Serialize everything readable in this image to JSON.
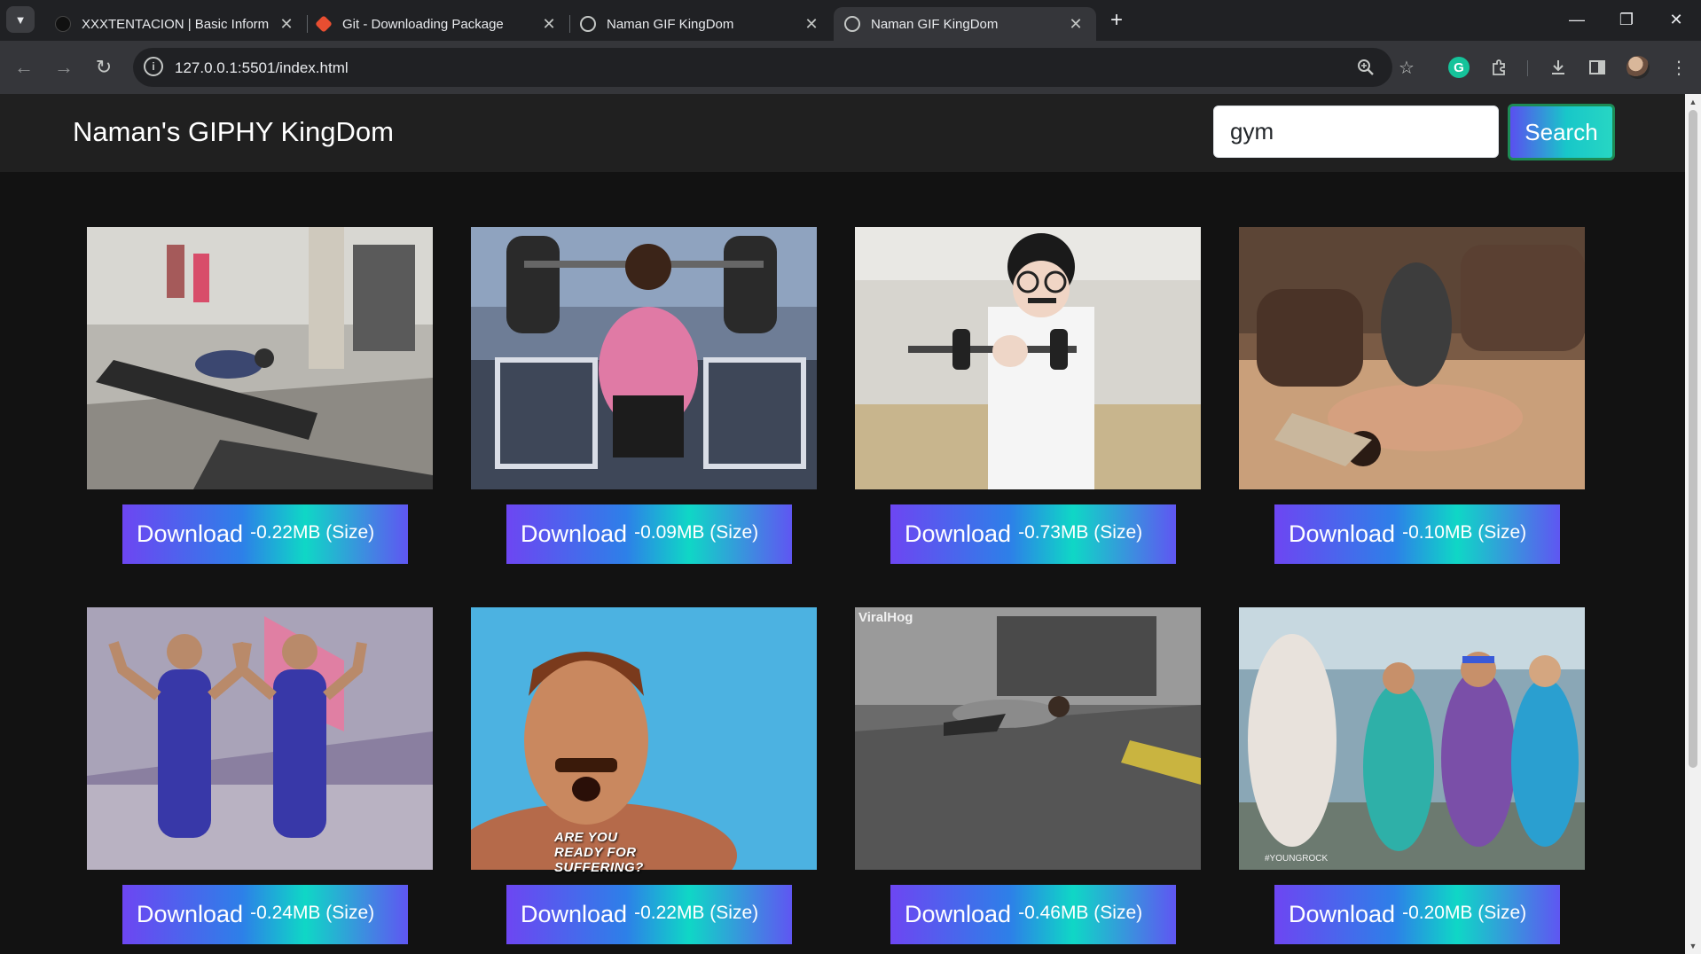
{
  "browser": {
    "tabs": [
      {
        "title": "XXXTENTACION | Basic Inform",
        "icon": "site-dark-icon",
        "active": false
      },
      {
        "title": "Git - Downloading Package",
        "icon": "git-icon",
        "active": false
      },
      {
        "title": "Naman GIF KingDom",
        "icon": "globe-icon",
        "active": false
      },
      {
        "title": "Naman GIF KingDom",
        "icon": "globe-icon",
        "active": true
      }
    ],
    "url": "127.0.0.1:5501/index.html",
    "colors": {
      "tabbar": "#202124",
      "toolbar": "#35363a",
      "active_tab": "#35363a"
    }
  },
  "page": {
    "brand": "Naman's GIPHY KingDom",
    "search": {
      "value": "gym",
      "button_label": "Search"
    },
    "colors": {
      "background": "#121212",
      "navbar": "#202020",
      "button_gradient": [
        "#5a4ff0",
        "#18c7c9"
      ]
    },
    "gifs": [
      {
        "download_label": "Download",
        "size_text": "-0.22MB (Size)",
        "subject": "man collapsed on treadmill"
      },
      {
        "download_label": "Download",
        "size_text": "-0.09MB (Size)",
        "subject": "woman lifting barbell in pink shirt"
      },
      {
        "download_label": "Download",
        "size_text": "-0.73MB (Size)",
        "subject": "man with glasses lifting dumbbell"
      },
      {
        "download_label": "Download",
        "size_text": "-0.10MB (Size)",
        "subject": "man falling onto floor in living room"
      },
      {
        "download_label": "Download",
        "size_text": "-0.24MB (Size)",
        "subject": "two men flexing in blue leotards"
      },
      {
        "download_label": "Download",
        "size_text": "-0.22MB (Size)",
        "subject": "mustached man shouting",
        "caption": "ARE YOU READY FOR SUFFERING?"
      },
      {
        "download_label": "Download",
        "size_text": "-0.46MB (Size)",
        "subject": "man fallen on gym floor",
        "watermark": "ViralHog"
      },
      {
        "download_label": "Download",
        "size_text": "-0.20MB (Size)",
        "subject": "aerobics class dancing",
        "watermark": "#YOUNGROCK"
      }
    ]
  }
}
